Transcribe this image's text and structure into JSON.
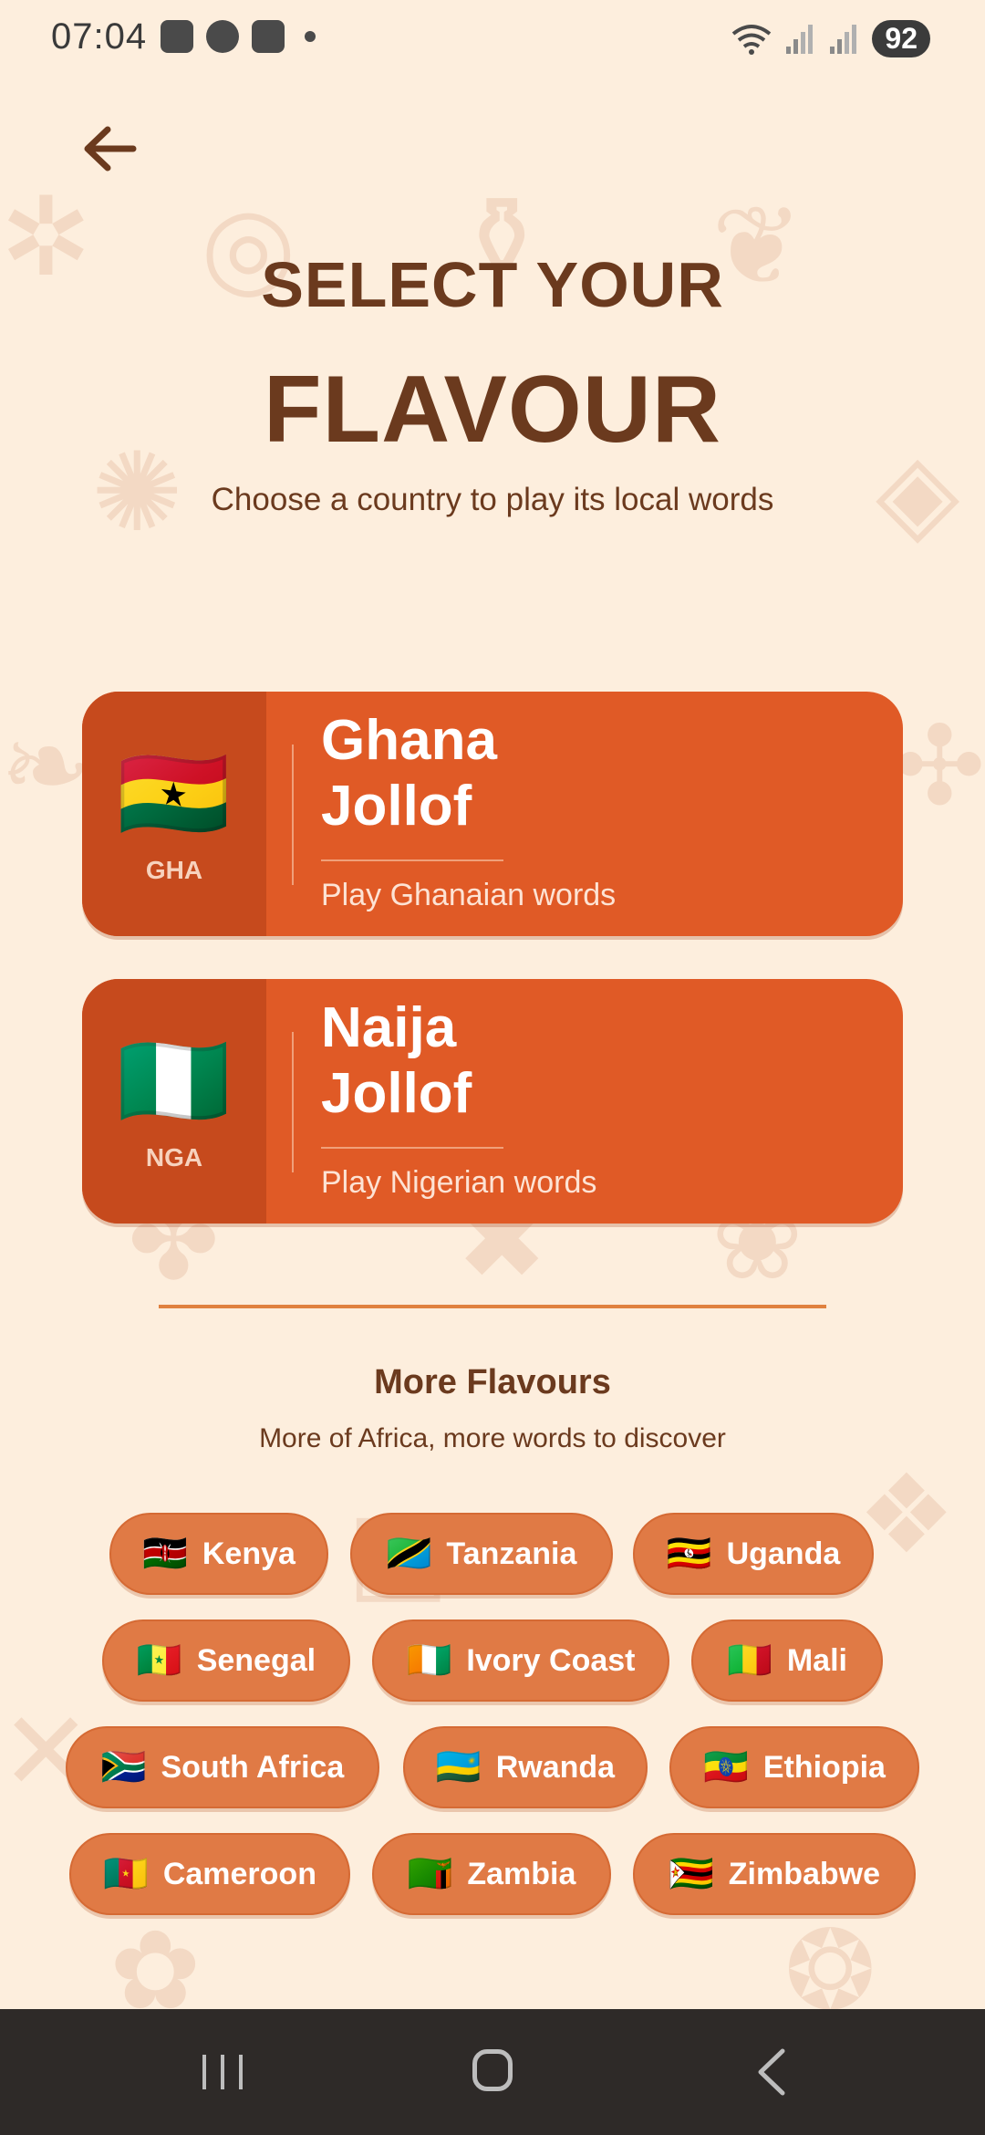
{
  "status_bar": {
    "time": "07:04",
    "battery": "92"
  },
  "header": {
    "title_line1": "SELECT YOUR",
    "title_line2": "FLAVOUR",
    "subtitle": "Choose a country to play its local words"
  },
  "featured": [
    {
      "flag": "🇬🇭",
      "code": "GHA",
      "title_line1": "Ghana",
      "title_line2": "Jollof",
      "subtitle": "Play Ghanaian words"
    },
    {
      "flag": "🇳🇬",
      "code": "NGA",
      "title_line1": "Naija",
      "title_line2": "Jollof",
      "subtitle": "Play Nigerian words"
    }
  ],
  "more": {
    "title": "More Flavours",
    "subtitle": "More of Africa, more words to discover",
    "countries": [
      {
        "flag": "🇰🇪",
        "name": "Kenya"
      },
      {
        "flag": "🇹🇿",
        "name": "Tanzania"
      },
      {
        "flag": "🇺🇬",
        "name": "Uganda"
      },
      {
        "flag": "🇸🇳",
        "name": "Senegal"
      },
      {
        "flag": "🇨🇮",
        "name": "Ivory Coast"
      },
      {
        "flag": "🇲🇱",
        "name": "Mali"
      },
      {
        "flag": "🇿🇦",
        "name": "South Africa"
      },
      {
        "flag": "🇷🇼",
        "name": "Rwanda"
      },
      {
        "flag": "🇪🇹",
        "name": "Ethiopia"
      },
      {
        "flag": "🇨🇲",
        "name": "Cameroon"
      },
      {
        "flag": "🇿🇲",
        "name": "Zambia"
      },
      {
        "flag": "🇿🇼",
        "name": "Zimbabwe"
      }
    ]
  },
  "colors": {
    "background": "#fdeedd",
    "card": "#e05a26",
    "card_accent": "#c64a1d",
    "chip": "#e07a45",
    "text": "#6b3a1e"
  }
}
